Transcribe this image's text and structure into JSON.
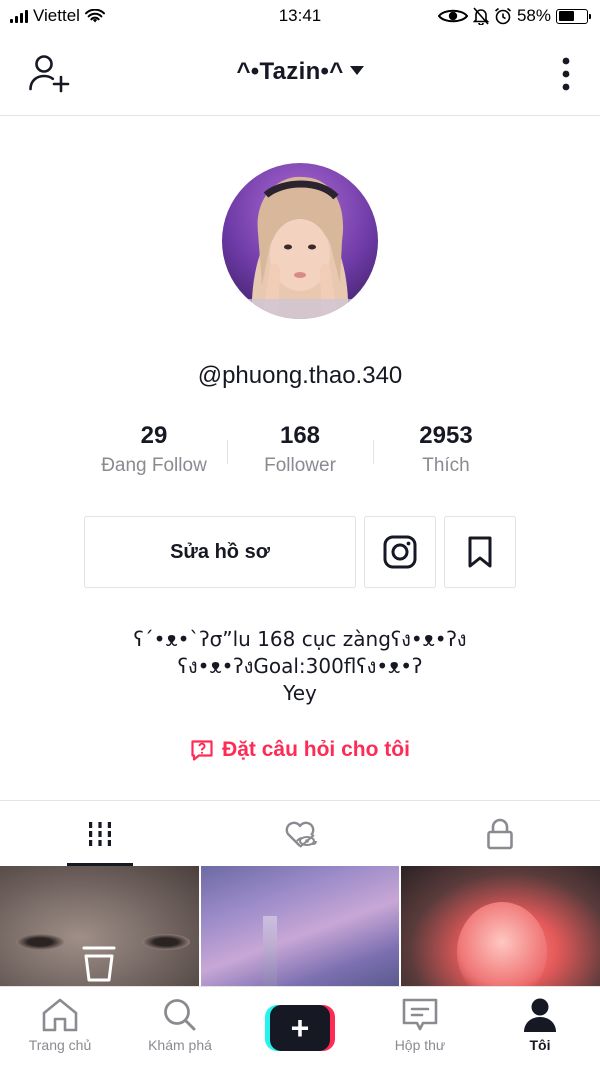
{
  "status_bar": {
    "carrier": "Viettel",
    "time": "13:41",
    "battery": "58%",
    "battery_level": 0.58
  },
  "header": {
    "title": "^•Tazin•^"
  },
  "profile": {
    "username": "@phuong.thao.340",
    "stats": [
      {
        "value": "29",
        "label": "Đang Follow"
      },
      {
        "value": "168",
        "label": "Follower"
      },
      {
        "value": "2953",
        "label": "Thích"
      }
    ],
    "edit_button": "Sửa hồ sơ",
    "bio": [
      "ʕ´•ᴥ•`ʔσ”lu 168 cục zàngʕง•ᴥ•ʔง",
      "ʕง•ᴥ•ʔงGoal:300flʕง•ᴥ•ʔ",
      "Yey"
    ],
    "ask_question": "Đặt câu hỏi cho tôi"
  },
  "tabs": [
    "videos-grid-icon",
    "liked-hidden-icon",
    "private-lock-icon"
  ],
  "bottom_nav": [
    {
      "label": "Trang chủ",
      "icon": "home-icon"
    },
    {
      "label": "Khám phá",
      "icon": "search-icon"
    },
    {
      "label": "",
      "icon": "create-plus-icon"
    },
    {
      "label": "Hộp thư",
      "icon": "inbox-icon"
    },
    {
      "label": "Tôi",
      "icon": "profile-icon"
    }
  ],
  "colors": {
    "accent": "#fe2c55",
    "cyan": "#25f4ee",
    "text": "#161823",
    "muted": "#8a8b91"
  }
}
